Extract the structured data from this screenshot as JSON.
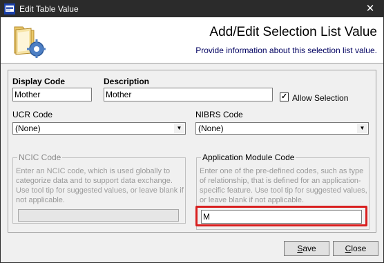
{
  "window": {
    "title": "Edit Table Value",
    "close_glyph": "✕"
  },
  "header": {
    "title": "Add/Edit Selection List Value",
    "subtitle": "Provide information about this selection list value.",
    "icon": "folder-gear-icon"
  },
  "form": {
    "display_code": {
      "label": "Display Code",
      "value": "Mother"
    },
    "description": {
      "label": "Description",
      "value": "Mother"
    },
    "allow_selection": {
      "label": "Allow Selection",
      "checked": true
    },
    "ucr_code": {
      "label": "UCR Code",
      "value": "(None)"
    },
    "nibrs_code": {
      "label": "NIBRS Code",
      "value": "(None)"
    },
    "ncic": {
      "title": "NCIC Code",
      "hint_lines": [
        "Enter an NCIC code, which is used globally to",
        "categorize data and to support data exchange.",
        "Use tool tip for suggested values, or leave blank if",
        "not applicable."
      ],
      "value": ""
    },
    "app_module": {
      "title": "Application Module Code",
      "hint_lines": [
        "Enter one of the pre-defined codes, such as type",
        "of relationship, that is defined for an application-",
        "specific feature. Use tool tip for suggested values,",
        "or leave blank if not applicable."
      ],
      "value": "M"
    }
  },
  "buttons": {
    "save": {
      "label_first": "S",
      "label_rest": "ave"
    },
    "close": {
      "label_first": "C",
      "label_rest": "lose"
    }
  },
  "colors": {
    "highlight": "#d81e1e",
    "titlebar": "#2b2b2b"
  }
}
